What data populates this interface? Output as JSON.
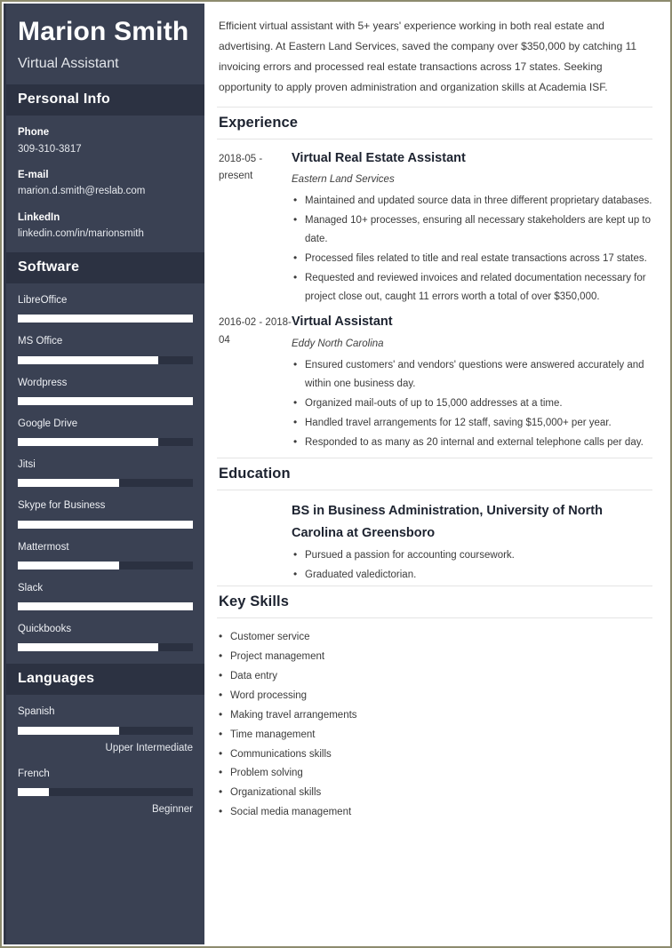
{
  "theme": {
    "sidebar_bg": "#3a4153",
    "sidebar_heading_bg": "#2c3242",
    "bar_track": "#2b3141",
    "bar_fill": "#ffffff",
    "page_border": "#8d8b6e",
    "text_dark": "#1d2330",
    "rule": "#e4e4e4"
  },
  "sidebar": {
    "name": "Marion Smith",
    "job_title": "Virtual Assistant",
    "personal_info": {
      "heading": "Personal Info",
      "items": [
        {
          "label": "Phone",
          "value": "309-310-3817"
        },
        {
          "label": "E-mail",
          "value": "marion.d.smith@reslab.com"
        },
        {
          "label": "LinkedIn",
          "value": "linkedin.com/in/marionsmith"
        }
      ]
    },
    "software": {
      "heading": "Software",
      "items": [
        {
          "label": "LibreOffice",
          "level": 100
        },
        {
          "label": "MS Office",
          "level": 80
        },
        {
          "label": "Wordpress",
          "level": 100
        },
        {
          "label": "Google Drive",
          "level": 80
        },
        {
          "label": "Jitsi",
          "level": 58
        },
        {
          "label": "Skype for Business",
          "level": 100
        },
        {
          "label": "Mattermost",
          "level": 58
        },
        {
          "label": "Slack",
          "level": 100
        },
        {
          "label": "Quickbooks",
          "level": 80
        }
      ]
    },
    "languages": {
      "heading": "Languages",
      "items": [
        {
          "label": "Spanish",
          "level": 58,
          "proficiency": "Upper Intermediate"
        },
        {
          "label": "French",
          "level": 18,
          "proficiency": "Beginner"
        }
      ]
    }
  },
  "main": {
    "summary": "Efficient virtual assistant with 5+ years' experience working in both real estate and advertising. At Eastern Land Services, saved the company over $350,000 by catching 11 invoicing errors and processed real estate transactions across 17 states. Seeking opportunity to apply proven administration and organization skills at Academia ISF.",
    "experience": {
      "heading": "Experience",
      "entries": [
        {
          "date": "2018-05 - present",
          "title": "Virtual Real Estate Assistant",
          "company": "Eastern Land Services",
          "bullets": [
            "Maintained and updated source data in three different proprietary databases.",
            "Managed 10+ processes, ensuring all necessary stakeholders are kept up to date.",
            "Processed files related to title and real estate transactions across 17 states.",
            "Requested and reviewed invoices and related documentation necessary for project close out, caught 11 errors worth a total of over $350,000."
          ]
        },
        {
          "date": "2016-02 - 2018-04",
          "title": "Virtual Assistant",
          "company": "Eddy North Carolina",
          "bullets": [
            "Ensured customers' and vendors' questions were answered accurately and within one business day.",
            "Organized mail-outs of up to 15,000 addresses at a time.",
            "Handled travel arrangements for 12 staff, saving $15,000+ per year.",
            "Responded to as many as 20 internal and external telephone calls per day."
          ]
        }
      ]
    },
    "education": {
      "heading": "Education",
      "entries": [
        {
          "title": "BS in Business Administration, University of North Carolina at Greensboro",
          "bullets": [
            "Pursued a passion for accounting coursework.",
            "Graduated valedictorian."
          ]
        }
      ]
    },
    "key_skills": {
      "heading": "Key Skills",
      "items": [
        "Customer service",
        "Project management",
        "Data entry",
        "Word processing",
        "Making travel arrangements",
        "Time management",
        "Communications skills",
        "Problem solving",
        "Organizational skills",
        "Social media management"
      ]
    }
  }
}
